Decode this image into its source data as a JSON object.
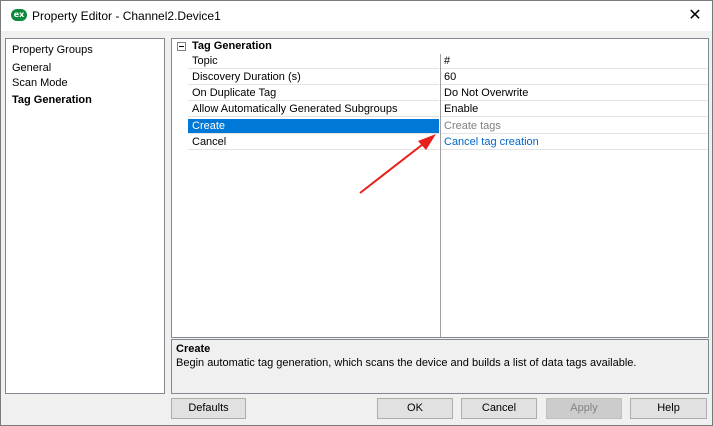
{
  "window": {
    "title": "Property Editor - Channel2.Device1",
    "app_icon_text": "ex",
    "close_glyph": "✕"
  },
  "groups": {
    "header": "Property Groups",
    "items": [
      {
        "label": "General",
        "selected": false
      },
      {
        "label": "Scan Mode",
        "selected": false
      },
      {
        "label": "Tag Generation",
        "selected": true
      }
    ]
  },
  "grid": {
    "category": "Tag Generation",
    "rows": [
      {
        "name": "Topic",
        "value": "#"
      },
      {
        "name": "Discovery Duration (s)",
        "value": "60"
      },
      {
        "name": "On Duplicate Tag",
        "value": "Do Not Overwrite"
      },
      {
        "name": "Allow Automatically Generated Subgroups",
        "value": "Enable"
      },
      {
        "name": "Create",
        "value": "Create tags"
      },
      {
        "name": "Cancel",
        "value": "Cancel tag creation"
      }
    ]
  },
  "description": {
    "title": "Create",
    "text": "Begin automatic tag generation, which scans the device and builds a list of data tags available."
  },
  "buttons": {
    "defaults": "Defaults",
    "ok": "OK",
    "cancel": "Cancel",
    "apply": "Apply",
    "help": "Help"
  },
  "colors": {
    "selection": "#0078d7",
    "link": "#0066cc",
    "annotation_arrow": "#e8201c"
  }
}
